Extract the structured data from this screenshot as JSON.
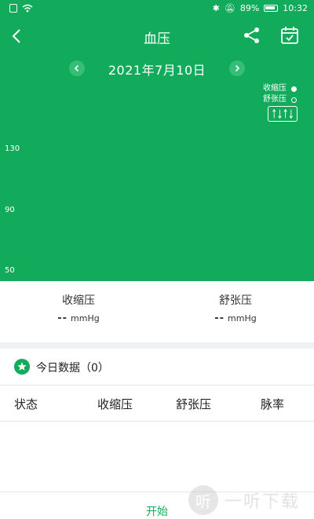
{
  "status_bar": {
    "battery": "89%",
    "time": "10:32"
  },
  "header": {
    "title": "血压"
  },
  "date_nav": {
    "date": "2021年7月10日"
  },
  "legend": {
    "systolic": "收缩压",
    "diastolic": "舒张压"
  },
  "chart_data": {
    "type": "line",
    "series": [],
    "ytick_labels": [
      "130",
      "90",
      "50"
    ],
    "xlabel": "",
    "ylabel": ""
  },
  "summary": {
    "systolic_label": "收缩压",
    "systolic_value": "--",
    "diastolic_label": "舒张压",
    "diastolic_value": "--",
    "unit": "mmHg"
  },
  "today": {
    "label": "今日数据（0）"
  },
  "table": {
    "headers": [
      "状态",
      "收缩压",
      "舒张压",
      "脉率"
    ]
  },
  "footer": {
    "start_label": "开始"
  },
  "watermark": {
    "text": "一听下载"
  },
  "colors": {
    "accent": "#12ab5b",
    "separator": "#eef2f3"
  },
  "icons": [
    "back-icon",
    "share-icon",
    "calendar-icon",
    "chevron-left-icon",
    "chevron-right-icon",
    "star-icon",
    "chart-toggle-icon"
  ]
}
